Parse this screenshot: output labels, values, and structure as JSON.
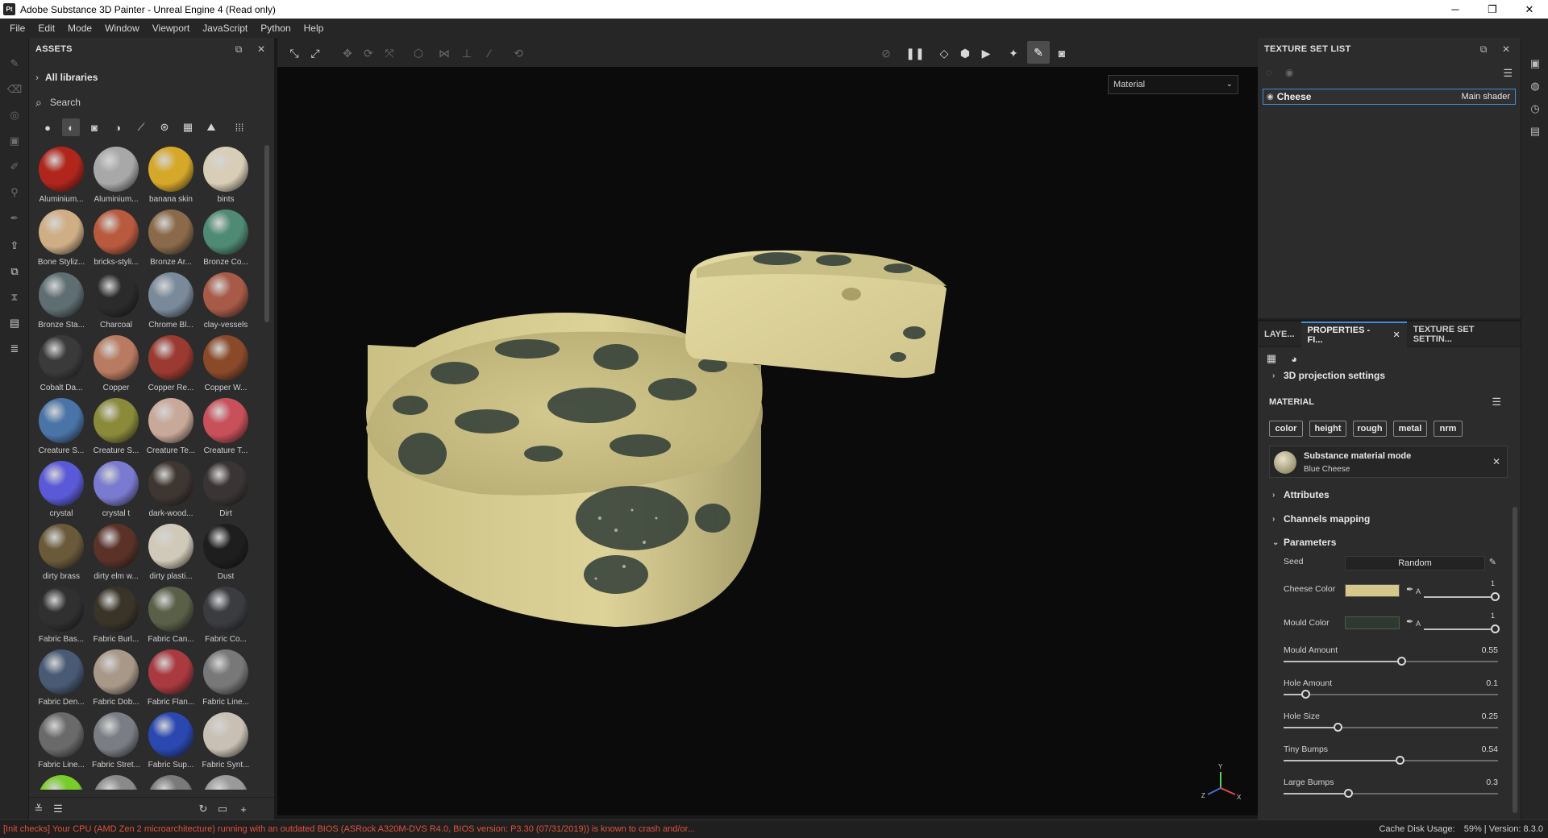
{
  "window": {
    "logo": "Pt",
    "title": "Adobe Substance 3D Painter - Unreal Engine 4 (Read only)",
    "controls": {
      "minimize": "─",
      "maximize": "❐",
      "close": "✕"
    }
  },
  "menu": [
    "File",
    "Edit",
    "Mode",
    "Window",
    "Viewport",
    "JavaScript",
    "Python",
    "Help"
  ],
  "assets": {
    "title": "ASSETS",
    "all_libraries": "All libraries",
    "search_placeholder": "Search",
    "items": [
      {
        "label": "Aluminium...",
        "color": "#b0261c"
      },
      {
        "label": "Aluminium...",
        "color": "#a8a8a8"
      },
      {
        "label": "banana skin",
        "color": "#d6a82a"
      },
      {
        "label": "bints",
        "color": "#d8cdb6"
      },
      {
        "label": "Bone Styliz...",
        "color": "#cfae86"
      },
      {
        "label": "bricks-styli...",
        "color": "#b95a3f"
      },
      {
        "label": "Bronze Ar...",
        "color": "#8a6a4a"
      },
      {
        "label": "Bronze Co...",
        "color": "#4f8a74"
      },
      {
        "label": "Bronze Sta...",
        "color": "#5f6e72"
      },
      {
        "label": "Charcoal",
        "color": "#2b2b2b"
      },
      {
        "label": "Chrome Bl...",
        "color": "#7a8a9a"
      },
      {
        "label": "clay-vessels",
        "color": "#a85a48"
      },
      {
        "label": "Cobalt Da...",
        "color": "#3a3a3a"
      },
      {
        "label": "Copper",
        "color": "#b87a60"
      },
      {
        "label": "Copper Re...",
        "color": "#9a3a30"
      },
      {
        "label": "Copper W...",
        "color": "#8a4a2a"
      },
      {
        "label": "Creature S...",
        "color": "#4a74a8"
      },
      {
        "label": "Creature S...",
        "color": "#8a8a3a"
      },
      {
        "label": "Creature Te...",
        "color": "#c8a898"
      },
      {
        "label": "Creature T...",
        "color": "#c8505a"
      },
      {
        "label": "crystal",
        "color": "#5a5ad8"
      },
      {
        "label": "crystal t",
        "color": "#7a7ad0"
      },
      {
        "label": "dark-wood...",
        "color": "#3e3630"
      },
      {
        "label": "Dirt",
        "color": "#3a3534"
      },
      {
        "label": "dirty brass",
        "color": "#6a5a3a"
      },
      {
        "label": "dirty elm w...",
        "color": "#5a3228"
      },
      {
        "label": "dirty plasti...",
        "color": "#d0c8b8"
      },
      {
        "label": "Dust",
        "color": "#1e1e1e"
      },
      {
        "label": "Fabric Bas...",
        "color": "#303030"
      },
      {
        "label": "Fabric Burl...",
        "color": "#3a3428"
      },
      {
        "label": "Fabric Can...",
        "color": "#5a6048"
      },
      {
        "label": "Fabric Co...",
        "color": "#3a3c40"
      },
      {
        "label": "Fabric Den...",
        "color": "#485a74"
      },
      {
        "label": "Fabric Dob...",
        "color": "#a89888"
      },
      {
        "label": "Fabric Flan...",
        "color": "#a83a40"
      },
      {
        "label": "Fabric Line...",
        "color": "#787878"
      },
      {
        "label": "Fabric Line...",
        "color": "#6a6a6a"
      },
      {
        "label": "Fabric Stret...",
        "color": "#7a7e84"
      },
      {
        "label": "Fabric Sup...",
        "color": "#2a48b0"
      },
      {
        "label": "Fabric Synt...",
        "color": "#c8c0b4"
      },
      {
        "label": "",
        "color": "#7acc2a"
      },
      {
        "label": "",
        "color": "#8a8a8a"
      },
      {
        "label": "",
        "color": "#7a7a7a"
      },
      {
        "label": "",
        "color": "#9a9a9a"
      }
    ]
  },
  "viewport": {
    "mode": "Material",
    "axis": {
      "x": "X",
      "y": "Y",
      "z": "Z"
    }
  },
  "texture_set_list": {
    "title": "TEXTURE SET LIST",
    "name": "Cheese",
    "shader": "Main shader"
  },
  "properties": {
    "tabs": [
      "LAYE...",
      "PROPERTIES - FI...",
      "TEXTURE SET SETTIN..."
    ],
    "projection": "3D projection settings",
    "material_title": "MATERIAL",
    "channels": [
      "color",
      "height",
      "rough",
      "metal",
      "nrm"
    ],
    "substance": {
      "title": "Substance material mode",
      "name": "Blue Cheese"
    },
    "sections": {
      "attributes": "Attributes",
      "channels_mapping": "Channels mapping",
      "parameters": "Parameters"
    },
    "seed": {
      "label": "Seed",
      "value": "Random"
    },
    "colors": [
      {
        "label": "Cheese Color",
        "swatch": "#d6c78a",
        "alpha_label": "A",
        "alpha": "1"
      },
      {
        "label": "Mould Color",
        "swatch": "#2e3a30",
        "alpha_label": "A",
        "alpha": "1"
      }
    ],
    "params": [
      {
        "label": "Mould Amount",
        "value": "0.55",
        "fraction": 0.55
      },
      {
        "label": "Hole Amount",
        "value": "0.1",
        "fraction": 0.1
      },
      {
        "label": "Hole Size",
        "value": "0.25",
        "fraction": 0.25
      },
      {
        "label": "Tiny Bumps",
        "value": "0.54",
        "fraction": 0.54
      },
      {
        "label": "Large Bumps",
        "value": "0.3",
        "fraction": 0.3
      }
    ]
  },
  "status": {
    "warning": "[Init checks] Your CPU (AMD Zen 2 microarchitecture) running with an outdated BIOS (ASRock A320M-DVS R4.0, BIOS version: P3.30 (07/31/2019)) is known to crash and/or...",
    "cache": "Cache Disk Usage:",
    "cache_value": "59%",
    "separator": "|",
    "version": "Version: 8.3.0"
  }
}
